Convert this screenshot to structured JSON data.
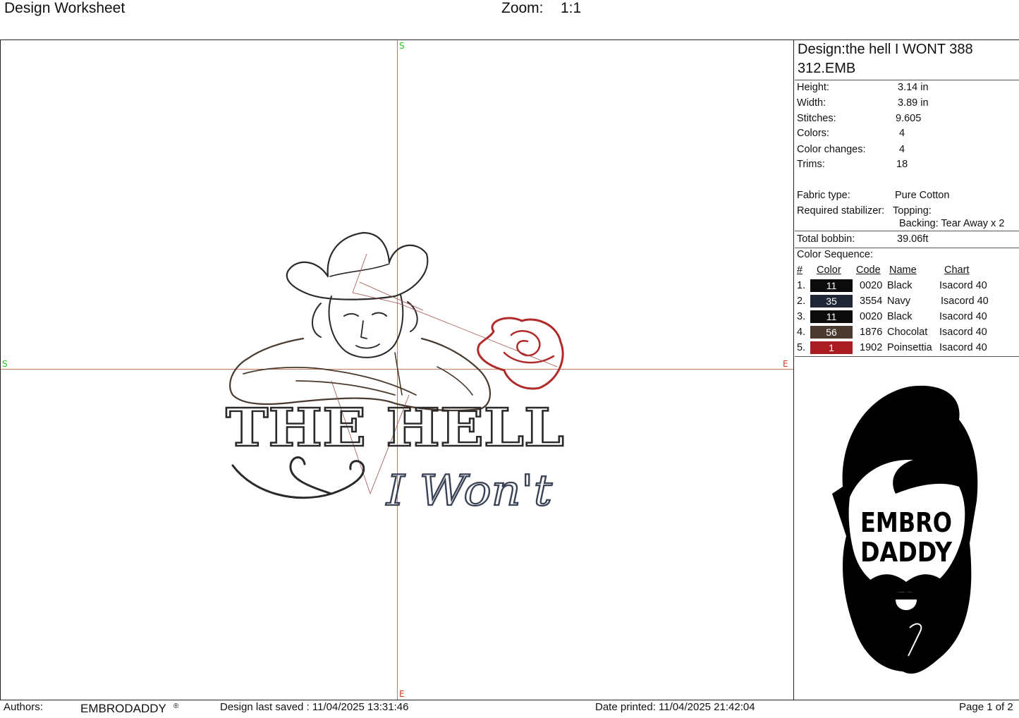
{
  "header": {
    "title": "Design Worksheet",
    "zoom_label": "Zoom:",
    "zoom_value": "1:1"
  },
  "canvas": {
    "markers": {
      "top": "S",
      "left": "S",
      "right": "E",
      "bottom": "E"
    },
    "artwork": {
      "line1": "THE HELL",
      "line2": "I Won't",
      "colors": {
        "outline": "#2a2a2a",
        "rose": "#b02a2a",
        "script": "#3a4356",
        "shirt": "#4a3a2e"
      }
    }
  },
  "panel": {
    "design_name": "Design:the hell I WONT 388 312.EMB",
    "specs": [
      {
        "label": "Height:",
        "value": "3.14 in"
      },
      {
        "label": "Width:",
        "value": "3.89 in"
      },
      {
        "label": "Stitches:",
        "value": "9.605"
      },
      {
        "label": "Colors:",
        "value": "4"
      },
      {
        "label": "Color changes:",
        "value": "4"
      },
      {
        "label": "Trims:",
        "value": "18"
      }
    ],
    "fabric_label": "Fabric type:",
    "fabric_value": "Pure Cotton",
    "stabilizer_label": "Required stabilizer:",
    "topping": "Topping:",
    "backing": "Backing: Tear Away x 2",
    "bobbin_label": "Total bobbin:",
    "bobbin_value": "39.06ft",
    "sequence_title": "Color Sequence:",
    "columns": {
      "num": "#",
      "color": "Color",
      "code": "Code",
      "name": "Name",
      "chart": "Chart"
    },
    "sequence": [
      {
        "num": "1.",
        "color": "11",
        "code": "0020",
        "name": "Black",
        "chart": "Isacord 40",
        "swatch": "#0b0b0b"
      },
      {
        "num": "2.",
        "color": "35",
        "code": "3554",
        "name": "Navy",
        "chart": "Isacord 40",
        "swatch": "#1f2636"
      },
      {
        "num": "3.",
        "color": "11",
        "code": "0020",
        "name": "Black",
        "chart": "Isacord 40",
        "swatch": "#0b0b0b"
      },
      {
        "num": "4.",
        "color": "56",
        "code": "1876",
        "name": "Chocolat",
        "chart": "Isacord 40",
        "swatch": "#4b3a30"
      },
      {
        "num": "5.",
        "color": "1",
        "code": "1902",
        "name": "Poinsettia",
        "chart": "Isacord 40",
        "swatch": "#a81c22"
      }
    ],
    "logo": {
      "line1": "EMBRO",
      "line2": "DADDY"
    }
  },
  "footer": {
    "authors_label": "Authors:",
    "authors_value": "EMBRODADDY",
    "registered": "®",
    "saved": "Design last saved : 11/04/2025 13:31:46",
    "printed": "Date printed: 11/04/2025 21:42:04",
    "page": "Page 1 of 2"
  }
}
